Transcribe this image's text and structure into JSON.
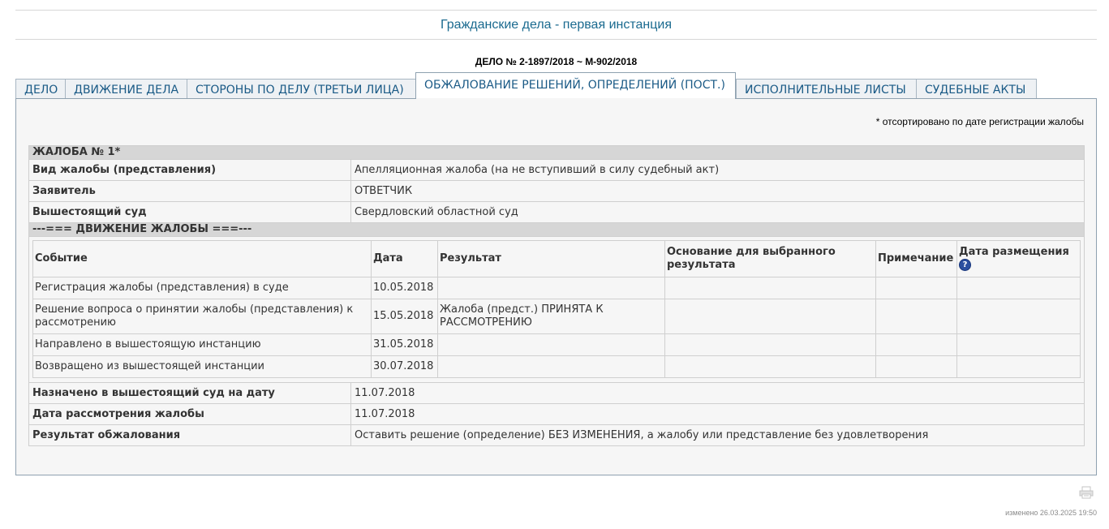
{
  "header": {
    "title": "Гражданские дела - первая инстанция",
    "case_number": "ДЕЛО № 2-1897/2018 ~ М-902/2018"
  },
  "tabs": [
    {
      "label": "ДЕЛО",
      "active": false
    },
    {
      "label": "ДВИЖЕНИЕ ДЕЛА",
      "active": false
    },
    {
      "label": "СТОРОНЫ ПО ДЕЛУ (ТРЕТЬИ ЛИЦА)",
      "active": false
    },
    {
      "label": "ОБЖАЛОВАНИЕ РЕШЕНИЙ, ОПРЕДЕЛЕНИЙ (ПОСТ.)",
      "active": true
    },
    {
      "label": "ИСПОЛНИТЕЛЬНЫЕ ЛИСТЫ",
      "active": false
    },
    {
      "label": "СУДЕБНЫЕ АКТЫ",
      "active": false
    }
  ],
  "sort_note": "* отсортировано по дате регистрации жалобы",
  "complaint": {
    "heading": "ЖАЛОБА № 1*",
    "fields": [
      {
        "label": "Вид жалобы (представления)",
        "value": "Апелляционная жалоба (на не вступивший в силу судебный акт)"
      },
      {
        "label": "Заявитель",
        "value": "ОТВЕТЧИК"
      },
      {
        "label": "Вышестоящий суд",
        "value": "Свердловский областной суд"
      }
    ],
    "movement_heading": "---=== ДВИЖЕНИЕ ЖАЛОБЫ ===---",
    "movement_columns": [
      "Событие",
      "Дата",
      "Результат",
      "Основание для выбранного результата",
      "Примечание",
      "Дата размещения"
    ],
    "movement_rows": [
      {
        "event": "Регистрация жалобы (представления) в суде",
        "date": "10.05.2018",
        "result": "",
        "basis": "",
        "note": "",
        "posted": ""
      },
      {
        "event": "Решение вопроса о принятии жалобы (представления) к рассмотрению",
        "date": "15.05.2018",
        "result": "Жалоба (предст.) ПРИНЯТА К РАССМОТРЕНИЮ",
        "basis": "",
        "note": "",
        "posted": ""
      },
      {
        "event": "Направлено в вышестоящую инстанцию",
        "date": "31.05.2018",
        "result": "",
        "basis": "",
        "note": "",
        "posted": ""
      },
      {
        "event": "Возвращено из вышестоящей инстанции",
        "date": "30.07.2018",
        "result": "",
        "basis": "",
        "note": "",
        "posted": ""
      }
    ],
    "bottom_fields": [
      {
        "label": "Назначено в вышестоящий суд на дату",
        "value": "11.07.2018"
      },
      {
        "label": "Дата рассмотрения жалобы",
        "value": "11.07.2018"
      },
      {
        "label": "Результат обжалования",
        "value": "Оставить решение (определение) БЕЗ ИЗМЕНЕНИЯ, а жалобу или представление без удовлетворения"
      }
    ]
  },
  "help_icon": {
    "glyph": "?",
    "name": "help-icon"
  },
  "footer": {
    "modified": "изменено 26.03.2025 19:50"
  },
  "colors": {
    "title": "#1a6a8f",
    "tab_text": "#1a5a86",
    "section_head_bg": "#d6d6d6",
    "help_icon": "#2b4f9f"
  }
}
